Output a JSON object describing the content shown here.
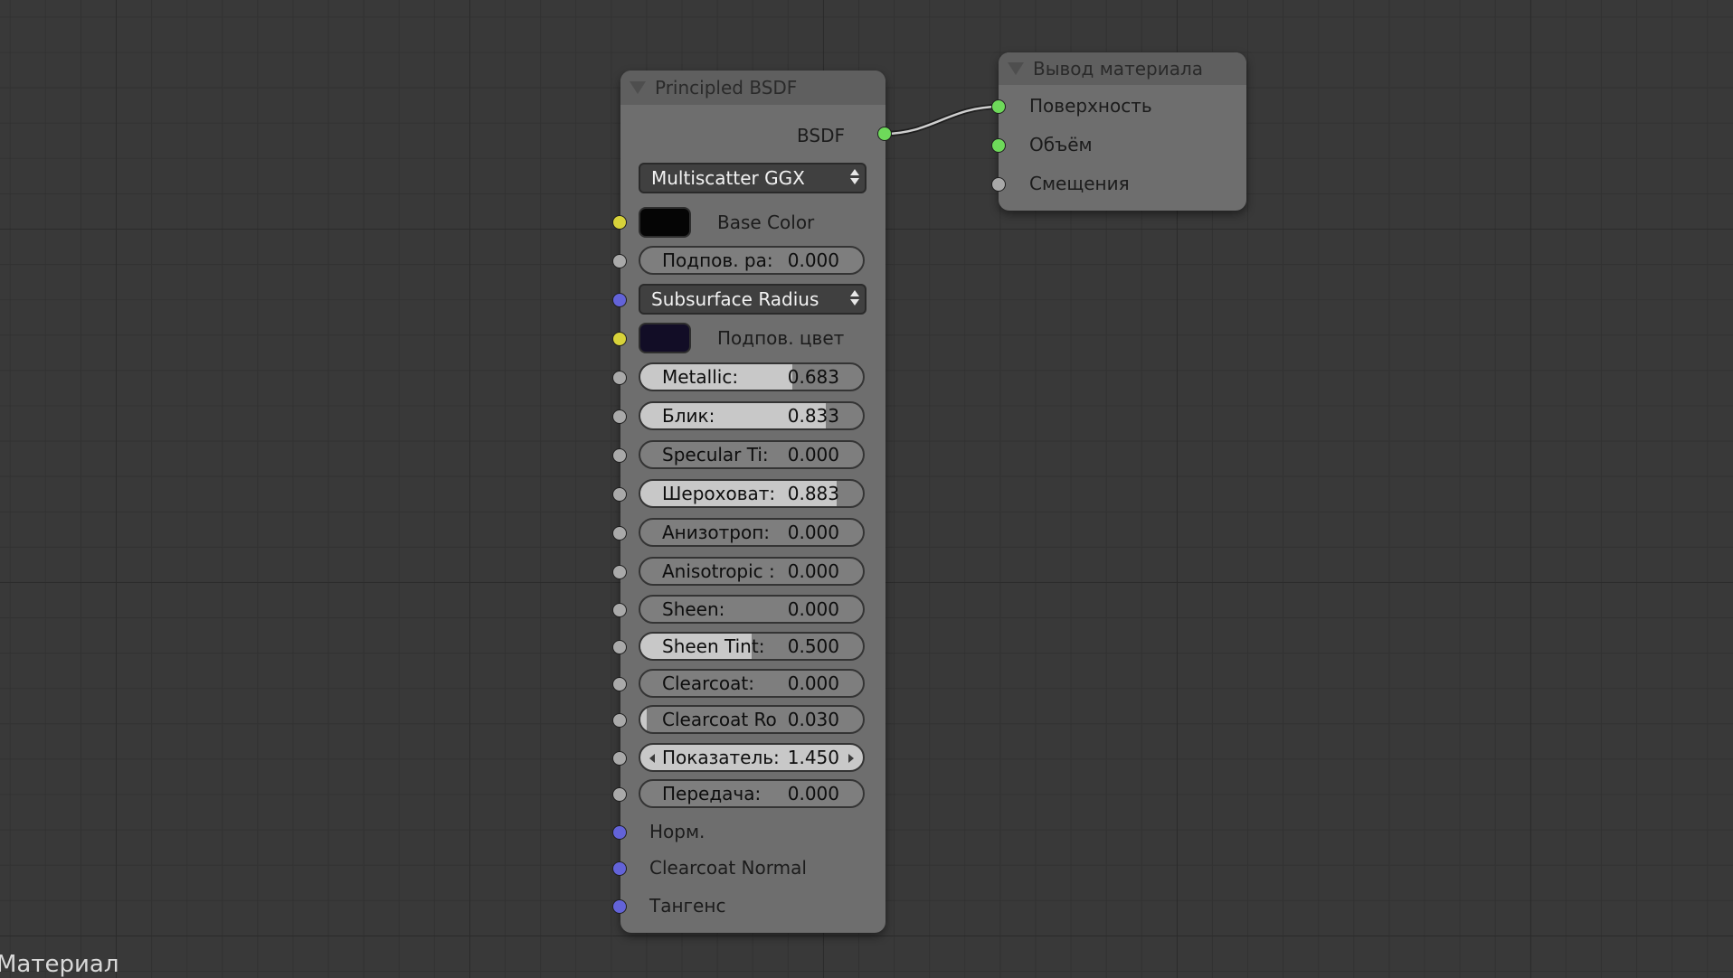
{
  "colors": {
    "socket_shader": "#6ed95a",
    "socket_color": "#d7d23a",
    "socket_float": "#a9a9a9",
    "socket_vector": "#6363d8",
    "base_color_swatch": "#050505",
    "subsurface_color_swatch": "#120d26"
  },
  "principled_node": {
    "title": "Principled BSDF",
    "output_label": "BSDF",
    "distribution": "Multiscatter GGX",
    "base_color_label": "Base Color",
    "subsurface_float": {
      "label": "Подпов. ра:",
      "value": "0.000",
      "fraction": 0.0
    },
    "subsurface_method": "Subsurface Radius",
    "subsurface_color_label": "Подпов. цвет",
    "metallic": {
      "label": "Metallic:",
      "value": "0.683",
      "fraction": 0.683
    },
    "specular": {
      "label": "Блик:",
      "value": "0.833",
      "fraction": 0.833
    },
    "specular_tint": {
      "label": "Specular Ti:",
      "value": "0.000",
      "fraction": 0.0
    },
    "roughness": {
      "label": "Шероховат:",
      "value": "0.883",
      "fraction": 0.883
    },
    "anisotropic": {
      "label": "Анизотроп:",
      "value": "0.000",
      "fraction": 0.0
    },
    "anisotropic_rotation": {
      "label": "Anisotropic :",
      "value": "0.000",
      "fraction": 0.0
    },
    "sheen": {
      "label": "Sheen:",
      "value": "0.000",
      "fraction": 0.0
    },
    "sheen_tint": {
      "label": "Sheen Tint:",
      "value": "0.500",
      "fraction": 0.5
    },
    "clearcoat": {
      "label": "Clearcoat:",
      "value": "0.000",
      "fraction": 0.0
    },
    "clearcoat_roughness": {
      "label": "Clearcoat Ro",
      "value": "0.030",
      "fraction": 0.03
    },
    "ior": {
      "label": "Показатель:",
      "value": "1.450"
    },
    "transmission": {
      "label": "Передача:",
      "value": "0.000",
      "fraction": 0.0
    },
    "normal_label": "Норм.",
    "clearcoat_normal_label": "Clearcoat Normal",
    "tangent_label": "Тангенс"
  },
  "output_node": {
    "title": "Вывод материала",
    "surface_label": "Поверхность",
    "volume_label": "Объём",
    "displacement_label": "Смещения"
  },
  "footer_label": "Материал"
}
